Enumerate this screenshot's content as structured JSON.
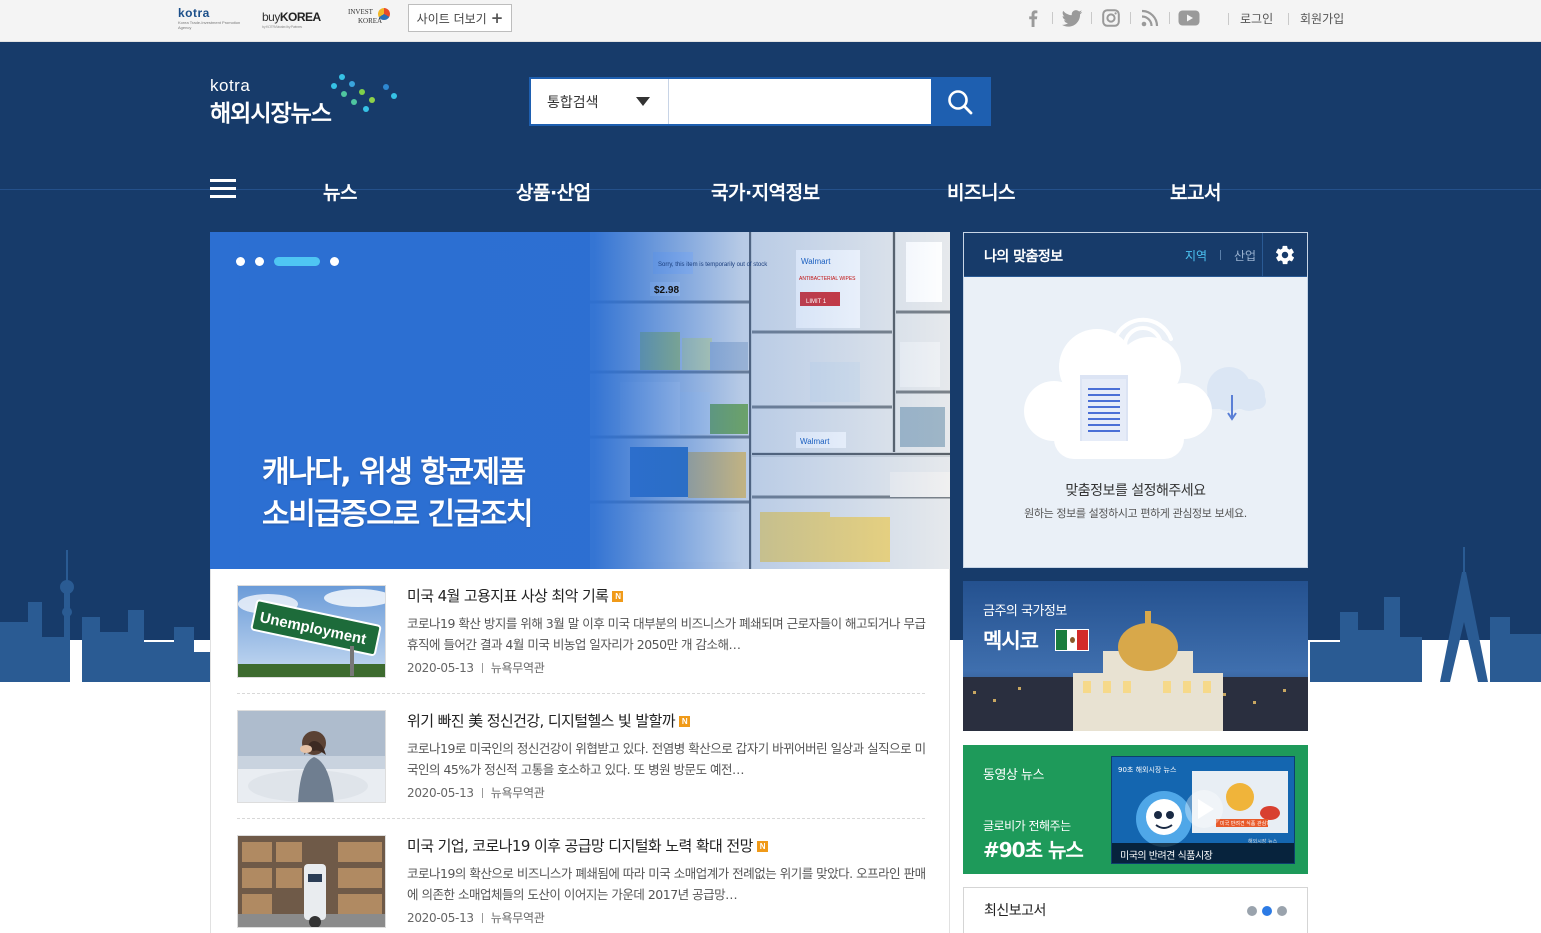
{
  "topbar": {
    "logo_kotra": "kotra",
    "logo_kotra_sub": "Korea Trade-Investment Promotion Agency",
    "logo_buykorea_1": "buy",
    "logo_buykorea_2": "KOREA",
    "logo_buykorea_sub": "by KOTRA trusted by Partners",
    "logo_invest_1": "INVEST",
    "logo_invest_2": "KOREA",
    "site_more_label": "사이트 더보기",
    "social_icons": [
      "facebook-icon",
      "twitter-icon",
      "instagram-icon",
      "rss-icon",
      "youtube-icon"
    ],
    "login_label": "로그인",
    "signup_label": "회원가입"
  },
  "header": {
    "brand_small": "kotra",
    "brand_name": "해외시장뉴스",
    "search_scope": "통합검색",
    "search_placeholder": "",
    "nav": [
      "뉴스",
      "상품·산업",
      "국가·지역정보",
      "비즈니스",
      "보고서"
    ]
  },
  "hero": {
    "title_line1": "캐나다, 위생 항균제품",
    "title_line2": "소비급증으로 긴급조치",
    "slide_count": 4,
    "active_slide": 3,
    "shelf_tag_1": "$2.98",
    "shelf_sign_1": "Sorry, this item is temporarily out of stock",
    "shelf_sign_2": "Walmart",
    "shelf_sign_3": "ANTIBACTERIAL WIPES",
    "shelf_sign_4": "LIMIT 1",
    "shelf_sign_5": "Walmart"
  },
  "news": [
    {
      "title": "미국 4월 고용지표 사상 최악 기록",
      "badge": "N",
      "summary": "코로나19 확산 방지를 위해 3월 말 이후 미국 대부분의 비즈니스가 폐쇄되며 근로자들이 해고되거나 무급 휴직에 들어간 결과 4월 미국 비농업 일자리가 2050만 개 감소해…",
      "date": "2020-05-13",
      "source": "뉴욕무역관",
      "thumb_text": "Unemployment"
    },
    {
      "title": "위기 빠진 美 정신건강, 디지털헬스 빛 발할까",
      "badge": "N",
      "summary": "코로나19로 미국인의 정신건강이 위협받고 있다. 전염병 확산으로 갑자기 바뀌어버린 일상과 실직으로 미국인의 45%가 정신적 고통을 호소하고 있다. 또 병원 방문도 예전…",
      "date": "2020-05-13",
      "source": "뉴욕무역관"
    },
    {
      "title": "미국 기업, 코로나19 이후 공급망 디지털화 노력 확대 전망",
      "badge": "N",
      "summary": "코로나19의 확산으로 비즈니스가 폐쇄됨에 따라 미국 소매업계가 전례없는 위기를 맞았다. 오프라인 판매에 의존한 소매업체들의 도산이 이어지는 가운데 2017년 공급망…",
      "date": "2020-05-13",
      "source": "뉴욕무역관"
    }
  ],
  "mypanel": {
    "title": "나의 맞춤정보",
    "tab_region": "지역",
    "tab_industry": "산업",
    "message": "맞춤정보를 설정해주세요",
    "sub_message": "원하는 정보를 설정하시고 편하게 관심정보 보세요."
  },
  "country": {
    "label": "금주의 국가정보",
    "name": "멕시코"
  },
  "video": {
    "label": "동영상 뉴스",
    "sub": "글로비가 전해주는",
    "big": "#90초 뉴스",
    "thumb_top": "90초 해외시장 뉴스",
    "thumb_caption": "미국의 반려견 식품시장",
    "thumb_mini_1": "미국 반려견 식품 관심?",
    "thumb_mini_2": "해외시장 뉴스"
  },
  "reports": {
    "title": "최신보고서"
  },
  "colors": {
    "topbar_bg": "#f4f4f4",
    "header_bg": "#173b6a",
    "accent": "#1e5fb0",
    "highlight": "#4cc4f3",
    "badge": "#f09a19",
    "video_bg": "#1e9a5a"
  }
}
